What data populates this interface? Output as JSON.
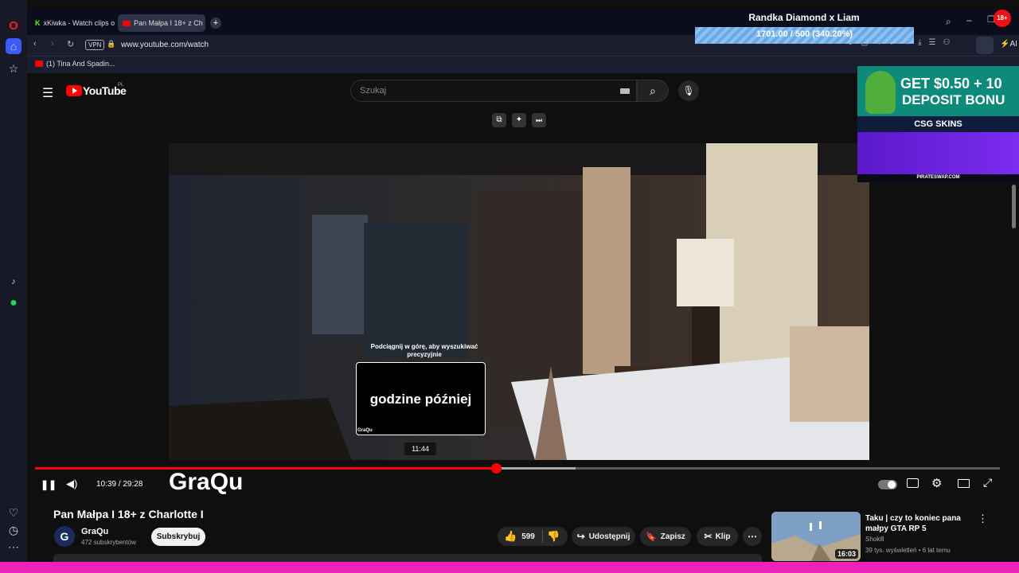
{
  "browser": {
    "tabs": [
      {
        "label": "xKiwka - Watch clips on K"
      },
      {
        "label": "Pan Małpa I 18+ z Ch"
      }
    ],
    "url": "www.youtube.com/watch",
    "vpn": "VPN",
    "bookmark": "(1) Tina And Spadin...",
    "ai_label": "AI"
  },
  "overlay": {
    "goal_title": "Randka Diamond x Liam",
    "goal_progress": "1701.00 / 500 (340.20%)",
    "goal_fraction": 1.0,
    "badge": "18+"
  },
  "youtube": {
    "logo": "YouTube",
    "region": "PL",
    "search_placeholder": "Szukaj",
    "video": {
      "scrub_hint": "Podciągnij w górę, aby wyszukiwać precyzyjnie",
      "preview_text": "godzine później",
      "preview_watermark": "GraQu",
      "preview_time": "11:44",
      "time": "10:39 / 29:28",
      "overlay_name": "GraQu",
      "played_fraction": 0.478,
      "buffered_fraction": 0.56
    },
    "title": "Pan Małpa I 18+ z Charlotte I",
    "channel": {
      "avatar": "G",
      "name": "GraQu",
      "subs": "472 subskrybentów",
      "subscribe": "Subskrybuj"
    },
    "actions": {
      "likes": "599",
      "share": "Udostępnij",
      "save": "Zapisz",
      "clip": "Klip"
    },
    "rec": {
      "title": "Taku | czy to koniec pana małpy GTA RP 5",
      "channel": "Shokill",
      "meta": "39 tys. wyświetleń • 6 lat temu",
      "duration": "16:03"
    }
  },
  "ad": {
    "line1": "GET $0.50 + 10",
    "line2": "DEPOSIT BONU",
    "brand": "CSG SKINS",
    "url": "PIRATESWAP.COM"
  }
}
